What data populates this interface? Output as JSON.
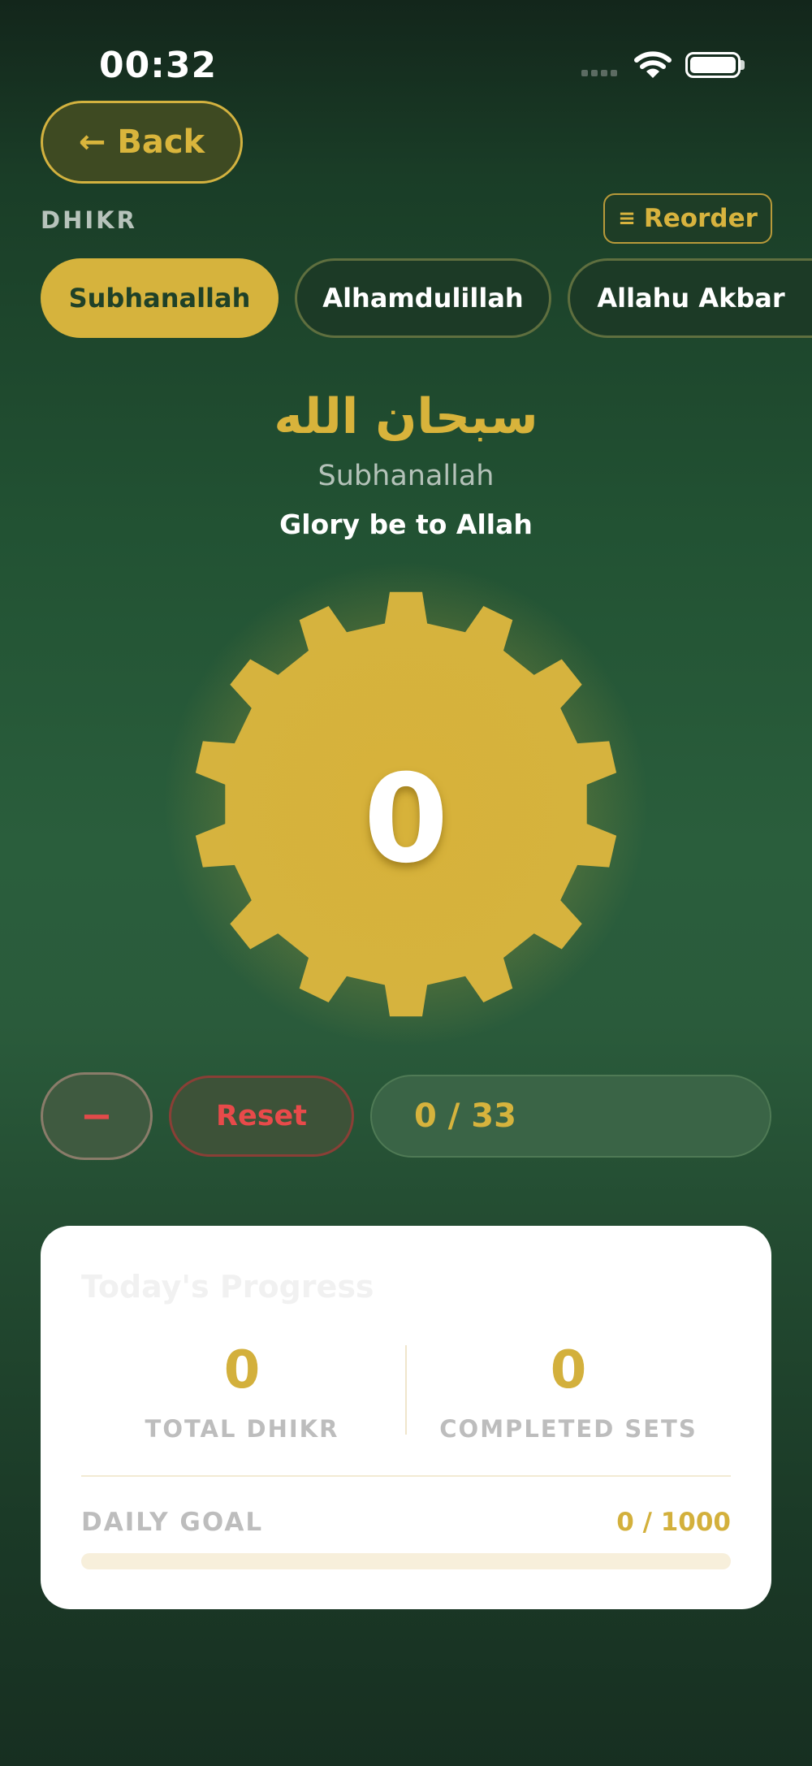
{
  "status_bar": {
    "time": "00:32"
  },
  "header": {
    "back_label": "Back",
    "section_label": "DHIKR",
    "reorder_label": "Reorder"
  },
  "tabs": [
    {
      "label": "Subhanallah",
      "active": true
    },
    {
      "label": "Alhamdulillah",
      "active": false
    },
    {
      "label": "Allahu Akbar",
      "active": false
    }
  ],
  "dhikr": {
    "arabic": "سبحان الله",
    "transliteration": "Subhanallah",
    "meaning": "Glory be to Allah"
  },
  "counter": {
    "count": "0"
  },
  "controls": {
    "decrement_label": "−",
    "reset_label": "Reset",
    "progress_text": "0 / 33"
  },
  "progress_card": {
    "title": "Today's Progress",
    "total_dhikr_value": "0",
    "total_dhikr_label": "TOTAL DHIKR",
    "completed_sets_value": "0",
    "completed_sets_label": "COMPLETED SETS",
    "daily_goal_label": "DAILY GOAL",
    "daily_goal_value": "0 / 1000",
    "daily_goal_fraction": 0
  },
  "icons": {
    "back": "arrow-left-icon",
    "reorder": "menu-lines-icon",
    "wifi": "wifi-icon",
    "battery": "battery-icon",
    "counter": "gear-icon"
  },
  "colors": {
    "accent_gold": "#d6b33d",
    "background_green": "#225233",
    "danger_red": "#e84a4a",
    "card_white": "#ffffff"
  }
}
